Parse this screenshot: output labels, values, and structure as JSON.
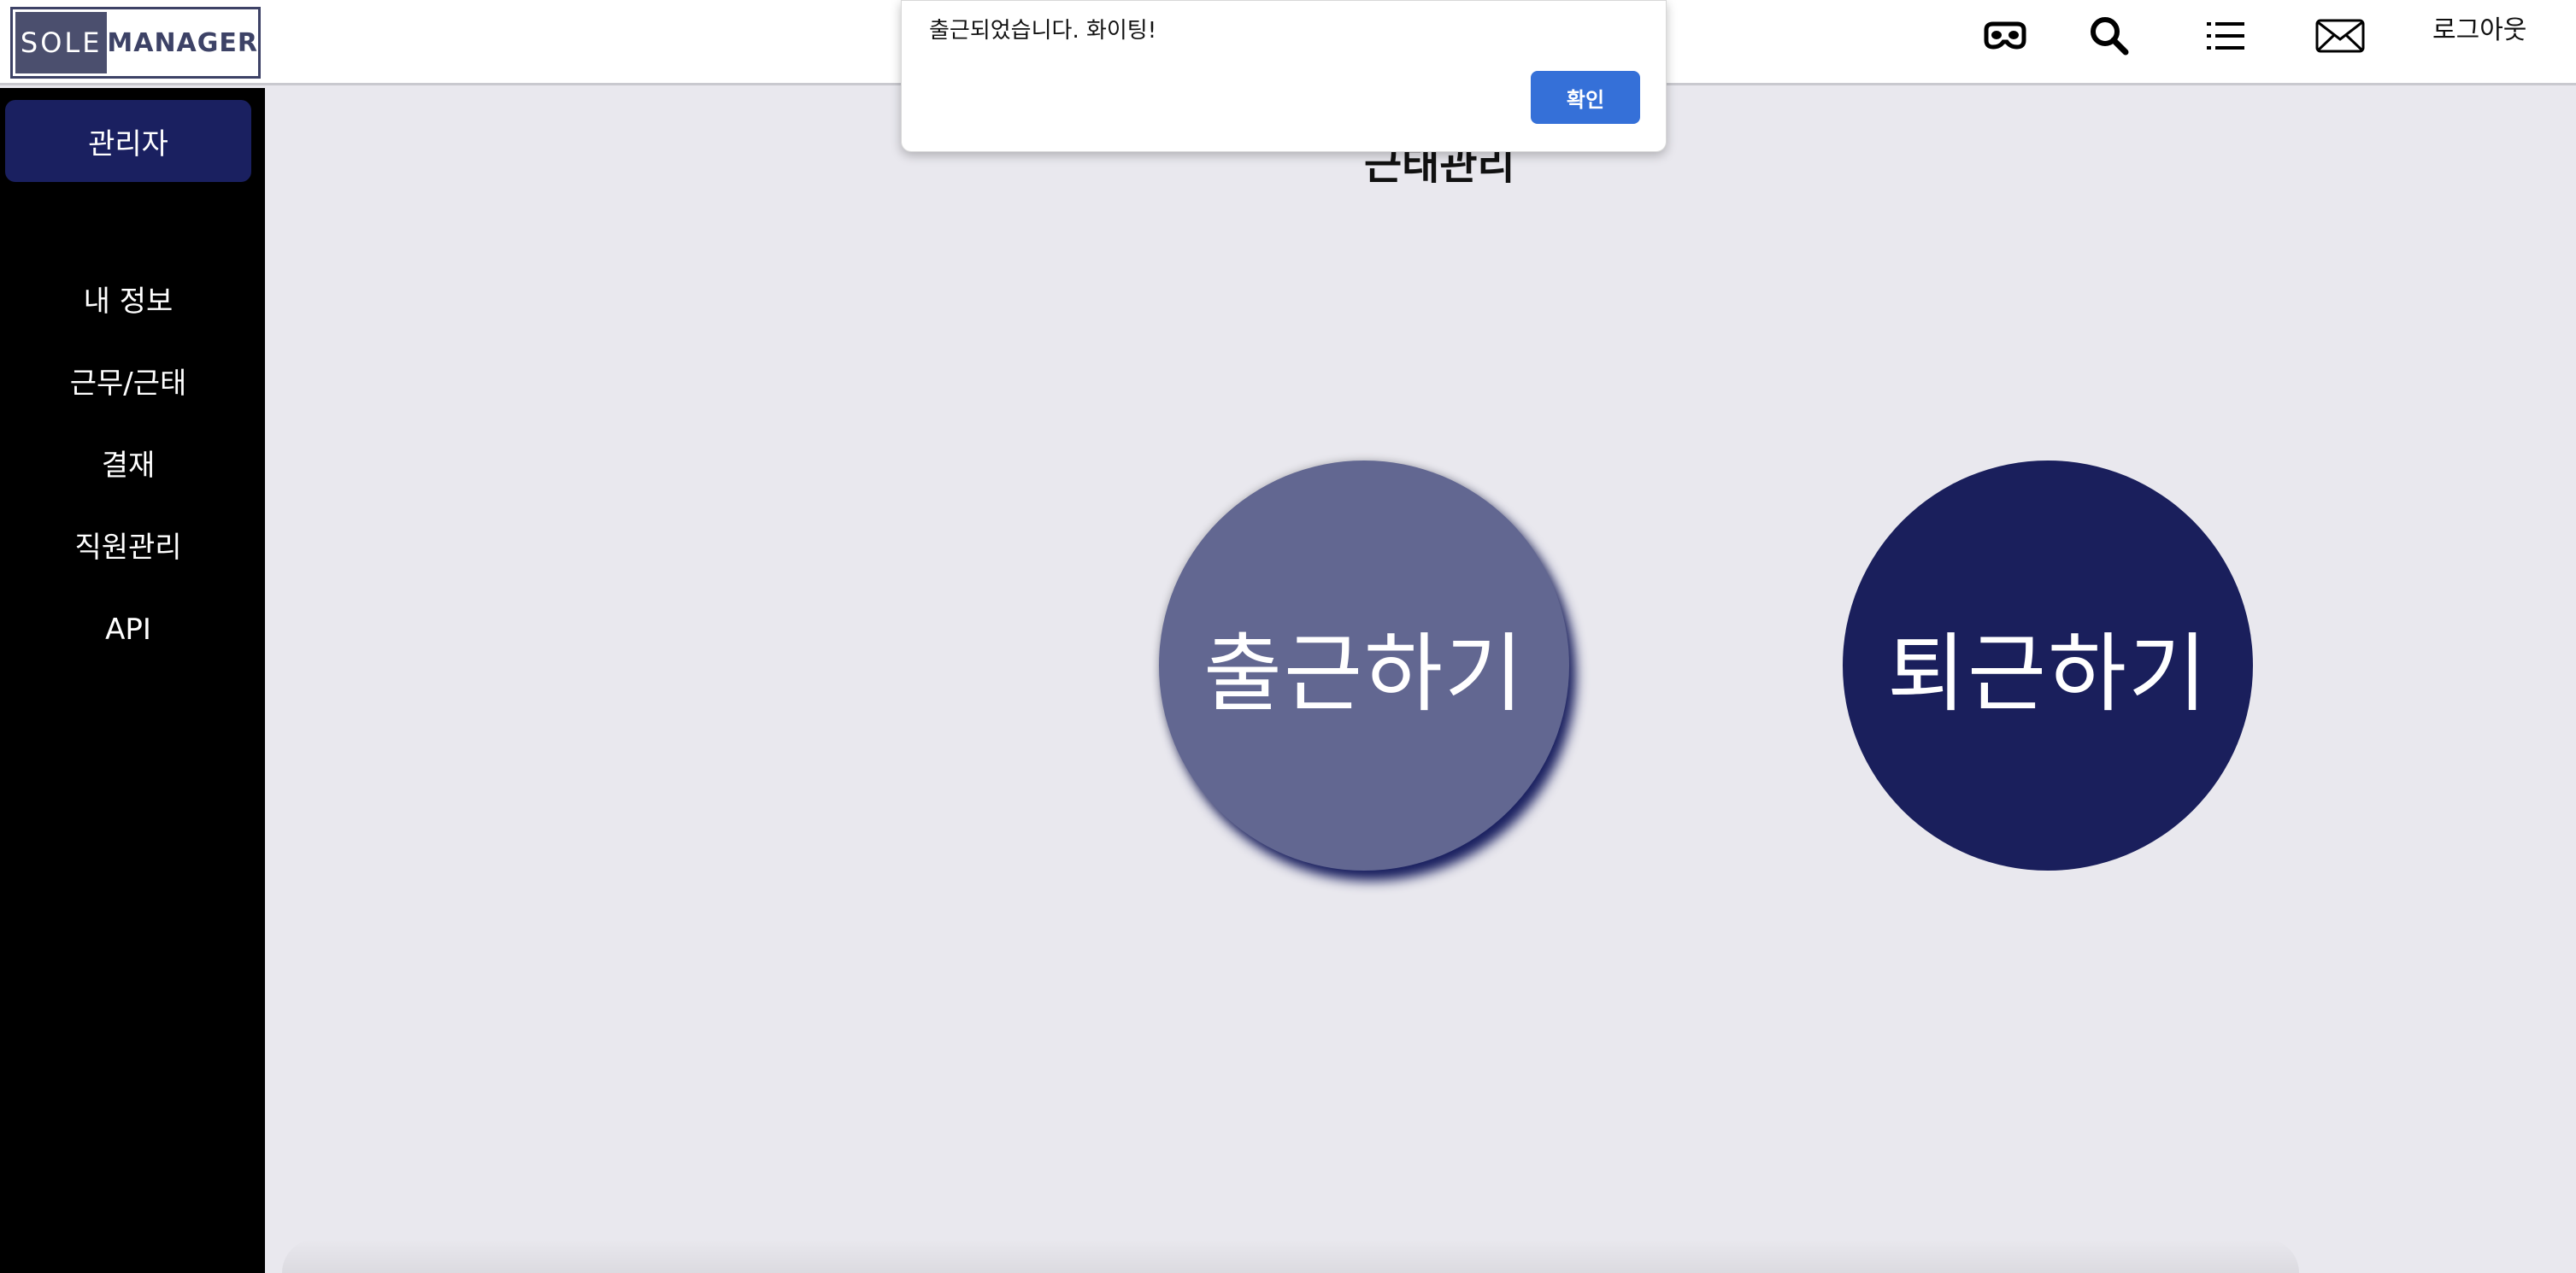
{
  "header": {
    "logo": {
      "part1": "SOLE",
      "part2": "MANAGER"
    },
    "icons": [
      "mask-icon",
      "search-icon",
      "list-icon",
      "mail-icon"
    ],
    "logout_label": "로그아웃"
  },
  "sidebar": {
    "role_label": "관리자",
    "items": [
      {
        "label": "내 정보"
      },
      {
        "label": "근무/근태"
      },
      {
        "label": "결재"
      },
      {
        "label": "직원관리"
      },
      {
        "label": "API"
      }
    ]
  },
  "main": {
    "title": "근태관리",
    "clock_in_label": "출근하기",
    "clock_out_label": "퇴근하기"
  },
  "dialog": {
    "message": "출근되었습니다. 화이팅!",
    "ok_label": "확인"
  },
  "colors": {
    "brand_navy": "#1a1f5c",
    "clock_in": "#626791",
    "dialog_button": "#3570d8",
    "background": "#e9e8ee"
  }
}
